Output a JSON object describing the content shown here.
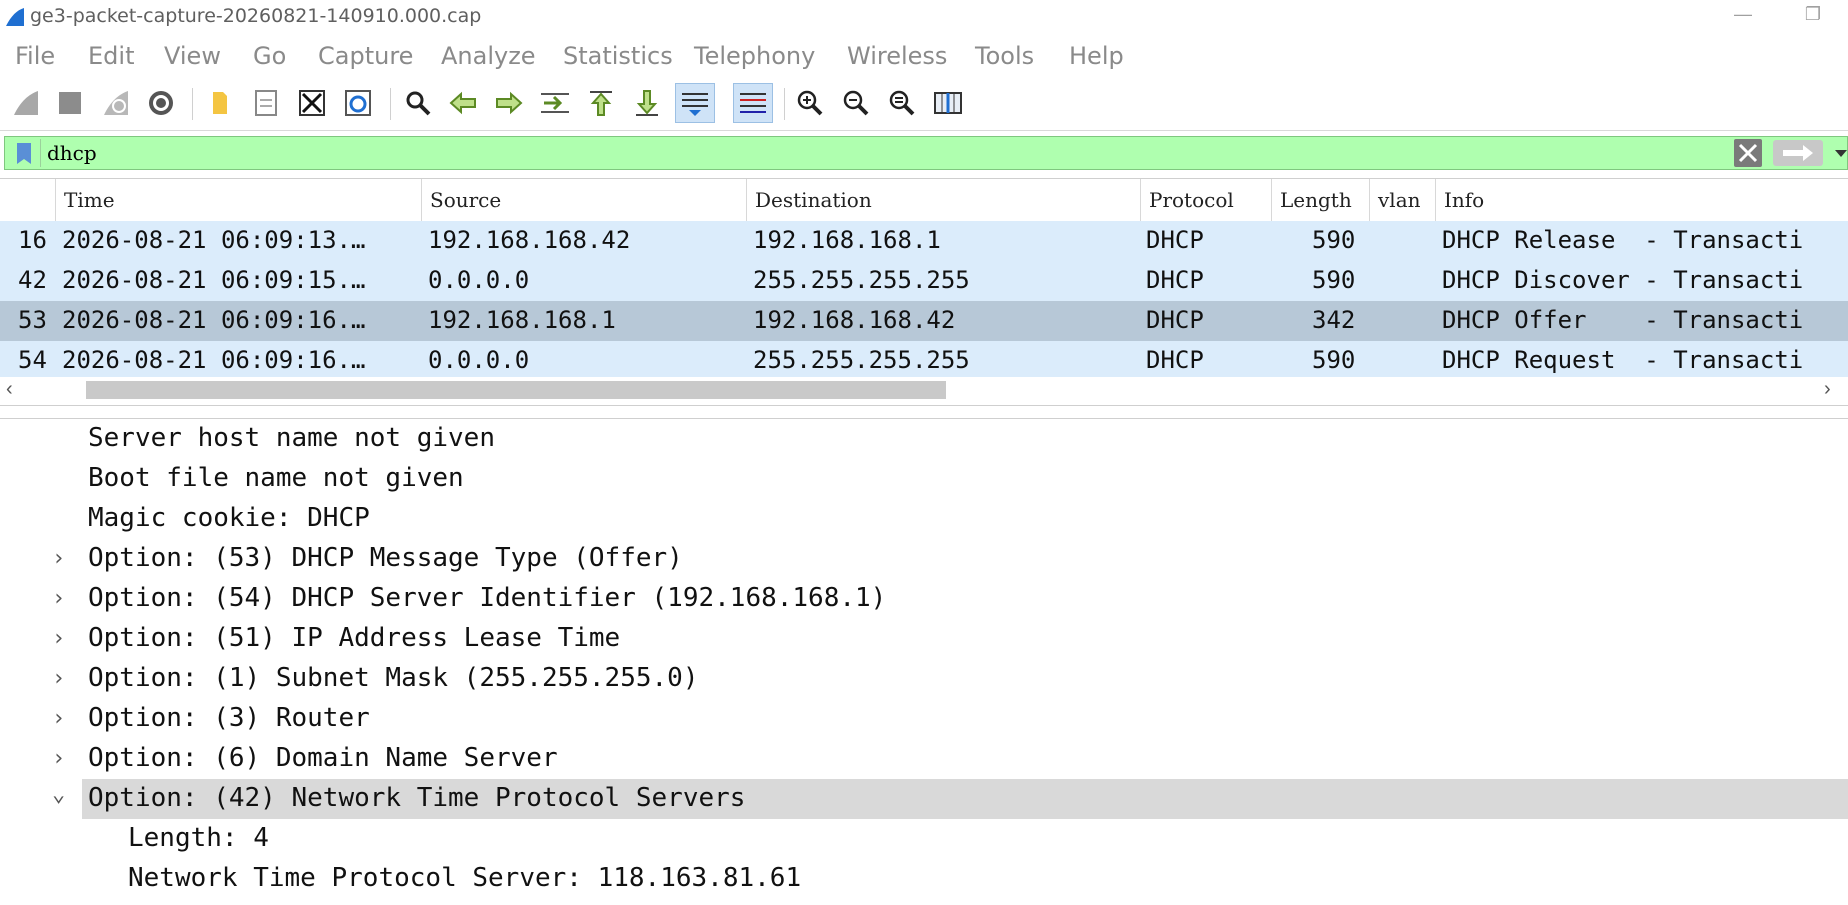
{
  "window": {
    "title": "ge3-packet-capture-20260821-140910.000.cap",
    "minimize": "—",
    "restore": "❐"
  },
  "menu": [
    "File",
    "Edit",
    "View",
    "Go",
    "Capture",
    "Analyze",
    "Statistics",
    "Telephony",
    "Wireless",
    "Tools",
    "Help"
  ],
  "toolbar": {
    "icons": [
      "start-capture-icon",
      "stop-capture-icon",
      "restart-capture-icon",
      "capture-options-icon",
      "open-file-icon",
      "save-file-icon",
      "close-file-icon",
      "reload-file-icon",
      "find-packet-icon",
      "go-back-icon",
      "go-forward-icon",
      "go-to-packet-icon",
      "first-packet-icon",
      "last-packet-icon",
      "auto-scroll-icon",
      "colorize-icon",
      "zoom-in-icon",
      "zoom-out-icon",
      "normal-size-icon",
      "resize-columns-icon"
    ]
  },
  "filter": {
    "value": "dhcp",
    "accent": "#afffaf"
  },
  "packet_list": {
    "columns": [
      "",
      "Time",
      "Source",
      "Destination",
      "Protocol",
      "Length",
      "vlan",
      "Info"
    ],
    "rows": [
      {
        "no": "16",
        "time": "2026-08-21 06:09:13.…",
        "source": "192.168.168.42",
        "destination": "192.168.168.1",
        "protocol": "DHCP",
        "length": "590",
        "vlan": "",
        "info": "DHCP Release  - Transacti"
      },
      {
        "no": "42",
        "time": "2026-08-21 06:09:15.…",
        "source": "0.0.0.0",
        "destination": "255.255.255.255",
        "protocol": "DHCP",
        "length": "590",
        "vlan": "",
        "info": "DHCP Discover - Transacti"
      },
      {
        "no": "53",
        "time": "2026-08-21 06:09:16.…",
        "source": "192.168.168.1",
        "destination": "192.168.168.42",
        "protocol": "DHCP",
        "length": "342",
        "vlan": "",
        "info": "DHCP Offer    - Transacti"
      },
      {
        "no": "54",
        "time": "2026-08-21 06:09:16.…",
        "source": "0.0.0.0",
        "destination": "255.255.255.255",
        "protocol": "DHCP",
        "length": "590",
        "vlan": "",
        "info": "DHCP Request  - Transacti"
      }
    ],
    "selected_row": "53",
    "row_color": "#dbecfb",
    "selected_color": "#b7c8d7"
  },
  "details": [
    {
      "text": "Server host name not given",
      "expander": ""
    },
    {
      "text": "Boot file name not given",
      "expander": ""
    },
    {
      "text": "Magic cookie: DHCP",
      "expander": ""
    },
    {
      "text": "Option: (53) DHCP Message Type (Offer)",
      "expander": "›"
    },
    {
      "text": "Option: (54) DHCP Server Identifier (192.168.168.1)",
      "expander": "›"
    },
    {
      "text": "Option: (51) IP Address Lease Time",
      "expander": "›"
    },
    {
      "text": "Option: (1) Subnet Mask (255.255.255.0)",
      "expander": "›"
    },
    {
      "text": "Option: (3) Router",
      "expander": "›"
    },
    {
      "text": "Option: (6) Domain Name Server",
      "expander": "›"
    },
    {
      "text": "Option: (42) Network Time Protocol Servers",
      "expander": "⌄"
    },
    {
      "text": "Length: 4",
      "expander": ""
    },
    {
      "text": "Network Time Protocol Server: 118.163.81.61",
      "expander": ""
    }
  ]
}
